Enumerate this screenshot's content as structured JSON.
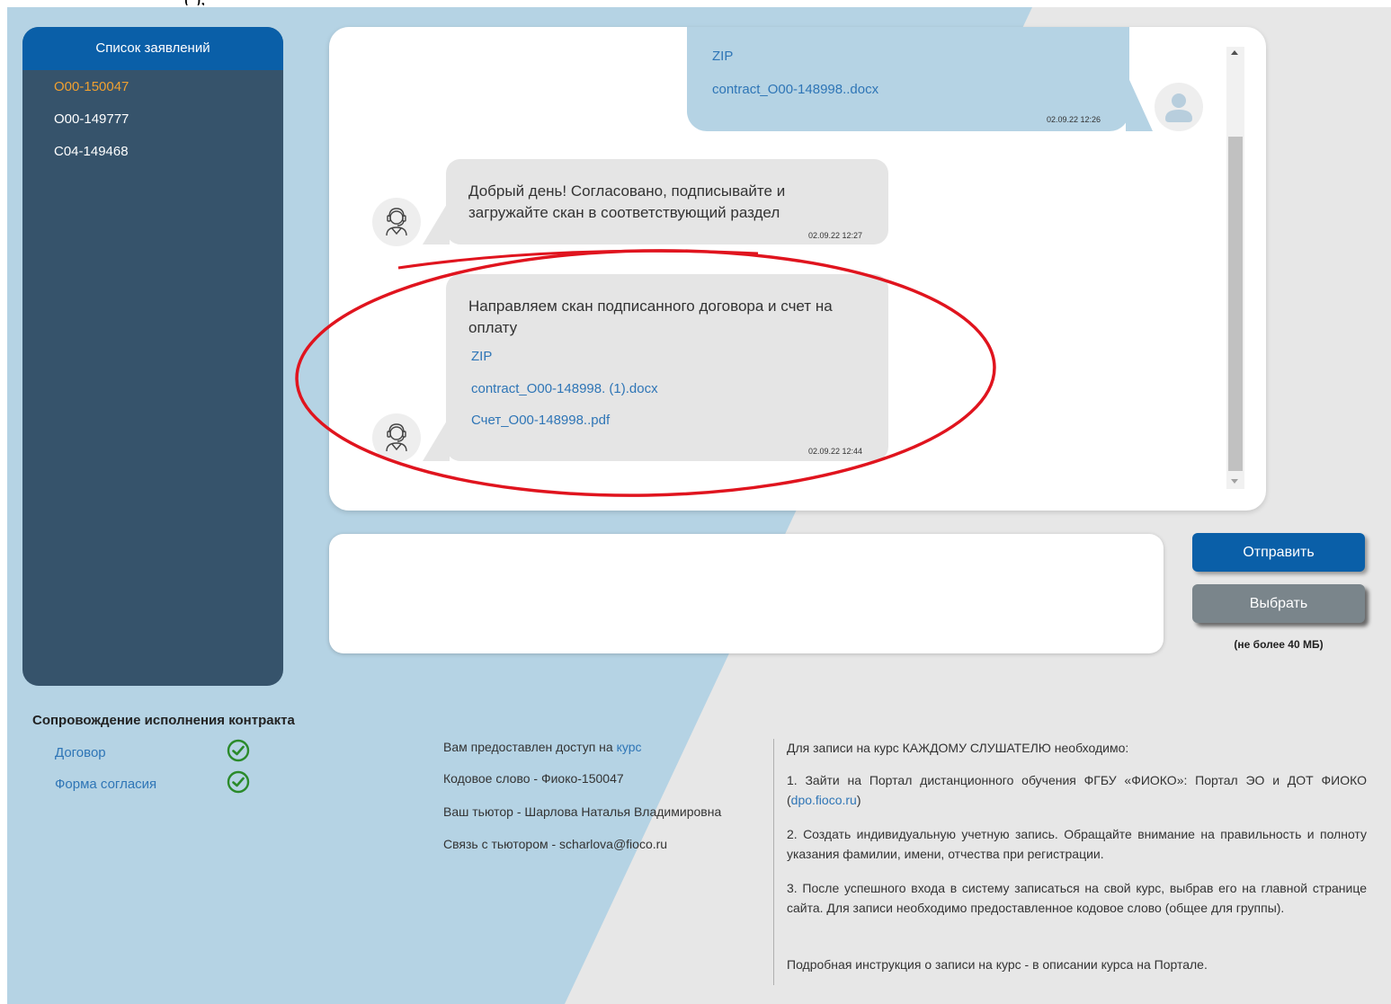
{
  "top_fragment": "(       ),",
  "sidebar": {
    "title": "Список заявлений",
    "items": [
      {
        "label": "О00-150047",
        "active": true
      },
      {
        "label": "О00-149777",
        "active": false
      },
      {
        "label": "С04-149468",
        "active": false
      }
    ]
  },
  "chat": {
    "msg_out_1": {
      "file_type": "ZIP",
      "file_name": "contract_О00-148998..docx",
      "time": "02.09.22 12:26"
    },
    "msg_in_1": {
      "text": "Добрый день! Согласовано, подписывайте и загружайте скан в соответствующий раздел",
      "time": "02.09.22 12:27"
    },
    "msg_in_2": {
      "text": "Направляем скан подписанного договора и счет на оплату",
      "file_type": "ZIP",
      "file_1": "contract_О00-148998. (1).docx",
      "file_2": "Счет_О00-148998..pdf",
      "time": "02.09.22 12:44"
    }
  },
  "composer": {
    "send_label": "Отправить",
    "choose_label": "Выбрать",
    "size_note": "(не более 40 МБ)"
  },
  "contract": {
    "title": "Сопровождение исполнения контракта",
    "items": [
      "Договор",
      "Форма согласия"
    ]
  },
  "access": {
    "line1_prefix": "Вам предоставлен доступ на ",
    "line1_link": "курс",
    "line2": "Кодовое слово - Фиоко-150047",
    "line3": "Ваш тьютор - Шарлова Наталья Владимировна",
    "line4": "Связь с тьютором - scharlova@fioco.ru"
  },
  "instructions": {
    "intro": "Для записи на курс КАЖДОМУ СЛУШАТЕЛЮ необходимо:",
    "step1_prefix": "1. Зайти на Портал дистанционного обучения ФГБУ «ФИОКО»: Портал ЭО и ДОТ ФИОКО (",
    "step1_link": "dpo.fioco.ru",
    "step1_suffix": ")",
    "step2": "2. Создать индивидуальную учетную запись. Обращайте внимание на правильность и полноту указания фамилии, имени, отчества при регистрации.",
    "step3": "3. После успешного входа в систему записаться на свой курс, выбрав его на главной странице сайта. Для записи необходимо предоставленное кодовое слово (общее для группы).",
    "footer": "Подробная инструкция о записи на курс - в описании курса на Портале."
  },
  "colors": {
    "brand_blue": "#0a5fa8",
    "sidebar_bg": "#36536b",
    "active_item": "#f0a030",
    "link": "#2e75b6",
    "annotation": "#e0141e",
    "check": "#2a8a2a"
  }
}
